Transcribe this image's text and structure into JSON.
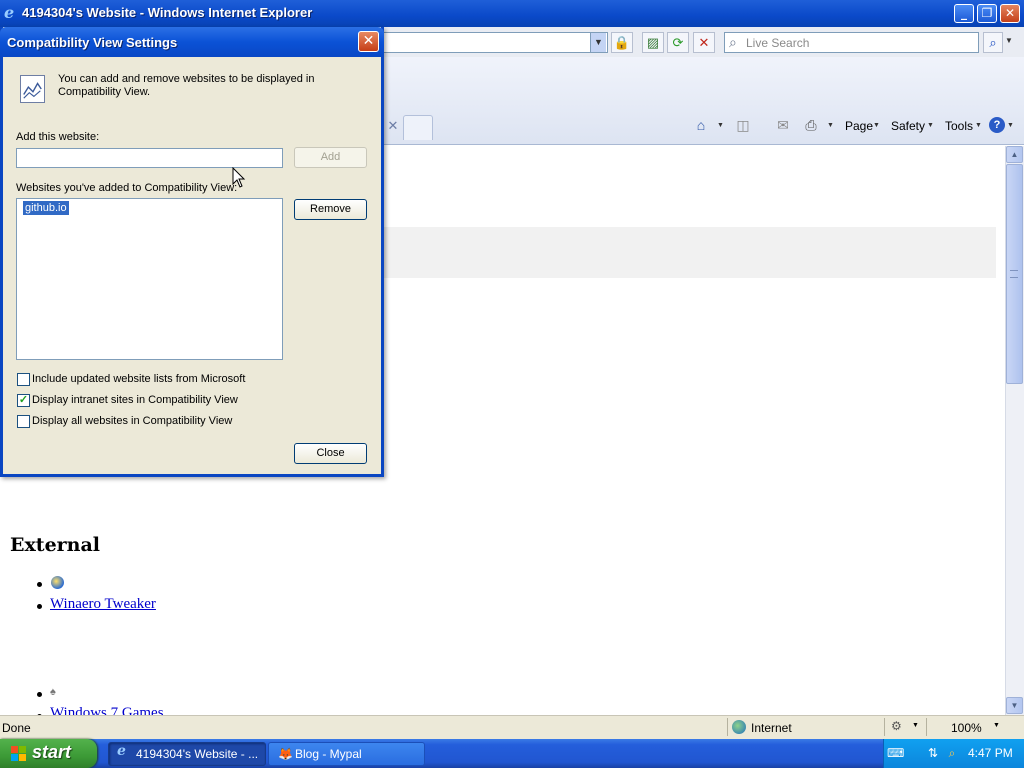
{
  "window": {
    "title": "4194304's Website - Windows Internet Explorer",
    "title_icon": "ie-logo-icon",
    "buttons": [
      "minimize",
      "restore",
      "close"
    ]
  },
  "toolbar": {
    "search_placeholder": "Live Search",
    "icons": [
      "lock-icon",
      "compat-icon",
      "refresh-icon",
      "stop-icon",
      "search-icon"
    ]
  },
  "command_bar": {
    "items": [
      {
        "label": "Page"
      },
      {
        "label": "Safety"
      },
      {
        "label": "Tools"
      }
    ],
    "icons": [
      "home-icon",
      "feeds-icon",
      "read-mail-icon",
      "print-icon",
      "help-icon"
    ]
  },
  "page": {
    "heading_external": "External",
    "links": [
      "Winaero Tweaker",
      "Windows 7 Games"
    ]
  },
  "dialog": {
    "title": "Compatibility View Settings",
    "intro": "You can add and remove websites to be displayed in Compatibility View.",
    "add_label": "Add this website:",
    "add_value": "",
    "add_button": "Add",
    "sites_label": "Websites you've added to Compatibility View:",
    "sites": [
      "github.io"
    ],
    "remove_button": "Remove",
    "checkboxes": [
      {
        "label": "Include updated website lists from Microsoft",
        "checked": false
      },
      {
        "label": "Display intranet sites in Compatibility View",
        "checked": true
      },
      {
        "label": "Display all websites in Compatibility View",
        "checked": false
      }
    ],
    "close_button": "Close"
  },
  "statusbar": {
    "status": "Done",
    "zone": "Internet",
    "zoom": "100%"
  },
  "taskbar": {
    "start": "start",
    "items": [
      {
        "label": "4194304's Website - ...",
        "active": true
      },
      {
        "label": "Blog - Mypal",
        "active": false
      }
    ],
    "clock": "4:47 PM"
  }
}
